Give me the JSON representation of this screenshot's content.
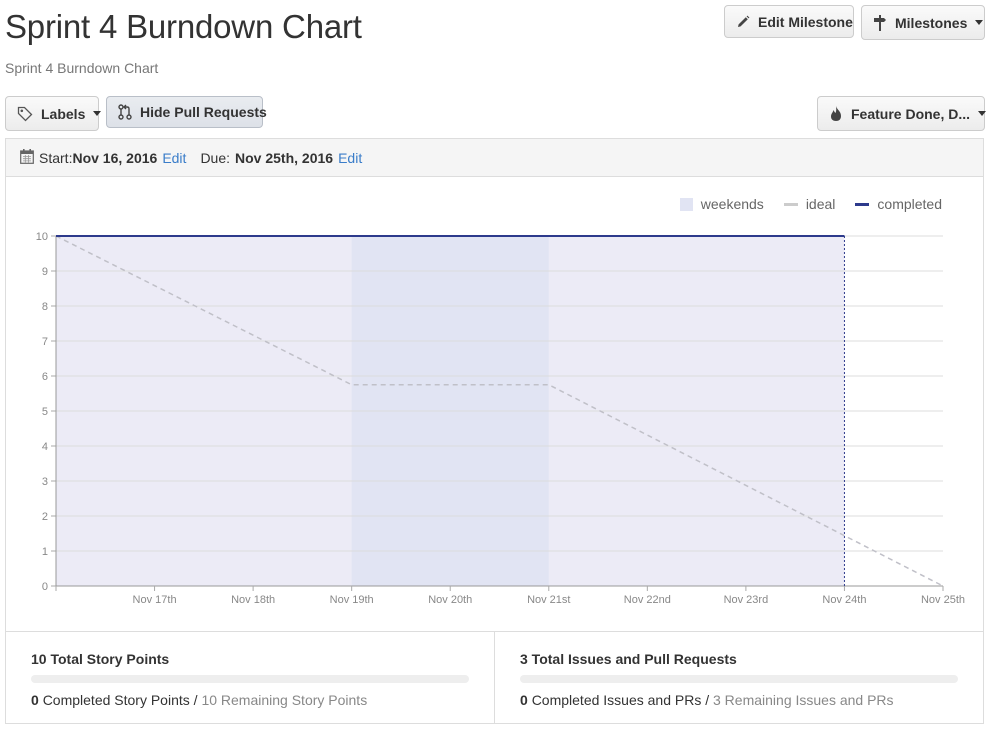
{
  "header": {
    "title": "Sprint 4 Burndown Chart",
    "subtitle": "Sprint 4 Burndown Chart"
  },
  "toolbar": {
    "edit_milestone": "Edit Milestone",
    "milestones": "Milestones",
    "labels": "Labels",
    "hide_pull_requests": "Hide Pull Requests",
    "feature_filter": "Feature Done, D..."
  },
  "dates": {
    "start_label": "Start:",
    "start_value": "Nov 16, 2016",
    "start_edit": "Edit",
    "due_label": "Due:",
    "due_value": "Nov 25th, 2016",
    "due_edit": "Edit"
  },
  "legend": {
    "weekends": "weekends",
    "ideal": "ideal",
    "completed": "completed"
  },
  "colors": {
    "completed": "#2d3a8c",
    "ideal": "#c0c0c8",
    "weekend_band": "#e1e4f3",
    "area_fill": "#ecebf6",
    "link": "#3a7dc9"
  },
  "chart_data": {
    "type": "line",
    "x": [
      "Nov 16th",
      "Nov 17th",
      "Nov 18th",
      "Nov 19th",
      "Nov 20th",
      "Nov 21st",
      "Nov 22nd",
      "Nov 23rd",
      "Nov 24th",
      "Nov 25th"
    ],
    "xtick_labels": [
      "Nov 17th",
      "Nov 18th",
      "Nov 19th",
      "Nov 20th",
      "Nov 21st",
      "Nov 22nd",
      "Nov 23rd",
      "Nov 24th",
      "Nov 25th"
    ],
    "yticks": [
      0,
      1,
      2,
      3,
      4,
      5,
      6,
      7,
      8,
      9,
      10
    ],
    "ylim": [
      0,
      10
    ],
    "weekend": {
      "from": "Nov 19th",
      "to": "Nov 21st"
    },
    "series": [
      {
        "name": "ideal",
        "style": "dashed",
        "points": [
          {
            "x": "Nov 16th",
            "y": 10
          },
          {
            "x": "Nov 19th",
            "y": 5.75
          },
          {
            "x": "Nov 21st",
            "y": 5.75
          },
          {
            "x": "Nov 25th",
            "y": 0
          }
        ]
      },
      {
        "name": "completed",
        "style": "solid",
        "points": [
          {
            "x": "Nov 16th",
            "y": 10
          },
          {
            "x": "Nov 24th",
            "y": 10
          }
        ]
      }
    ],
    "today": "Nov 24th",
    "grid": true,
    "legend_position": "top-right"
  },
  "stats": {
    "left": {
      "title": "10 Total Story Points",
      "completed_count": "0",
      "completed_text": "Completed Story Points /",
      "remaining_text": "10 Remaining Story Points",
      "progress": 0
    },
    "right": {
      "title": "3 Total Issues and Pull Requests",
      "completed_count": "0",
      "completed_text": "Completed Issues and PRs /",
      "remaining_text": "3 Remaining Issues and PRs",
      "progress": 0
    }
  }
}
